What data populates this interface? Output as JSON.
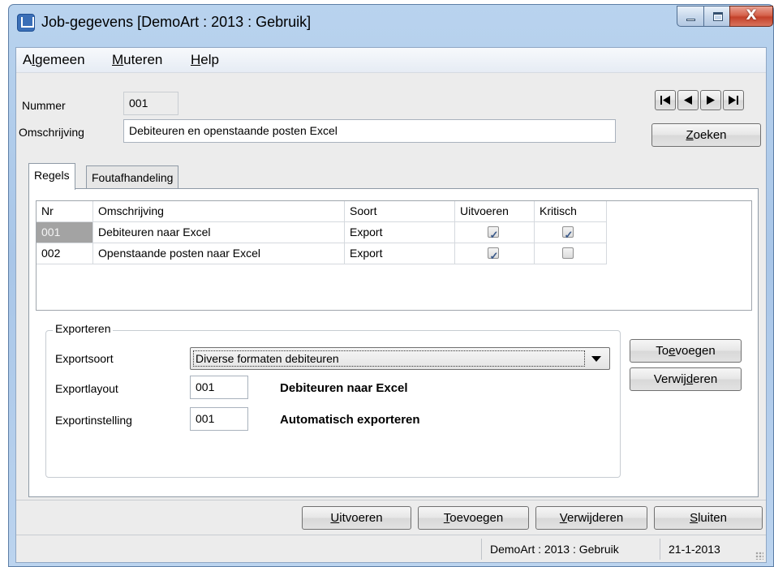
{
  "window": {
    "title": "Job-gegevens  [DemoArt : 2013 : Gebruik]",
    "close_symbol": "X"
  },
  "menu": {
    "items": [
      {
        "pre": "A",
        "acc": "l",
        "post": "gemeen"
      },
      {
        "pre": "",
        "acc": "M",
        "post": "uteren"
      },
      {
        "pre": "",
        "acc": "H",
        "post": "elp"
      }
    ]
  },
  "form": {
    "nummer_label": "Nummer",
    "nummer_value": "001",
    "omschrijving_label": "Omschrijving",
    "omschrijving_value": "Debiteuren en openstaande posten Excel",
    "zoeken": {
      "pre": "",
      "acc": "Z",
      "post": "oeken"
    }
  },
  "nav_icons": [
    "first-record-icon",
    "previous-record-icon",
    "next-record-icon",
    "last-record-icon"
  ],
  "tabs": [
    {
      "label": "Regels",
      "active": true
    },
    {
      "label": "Foutafhandeling",
      "active": false
    }
  ],
  "grid": {
    "headers": [
      "Nr",
      "Omschrijving",
      "Soort",
      "Uitvoeren",
      "Kritisch"
    ],
    "rows": [
      {
        "nr": "001",
        "omschrijving": "Debiteuren naar Excel",
        "soort": "Export",
        "uitvoeren": true,
        "kritisch": true,
        "selected": true
      },
      {
        "nr": "002",
        "omschrijving": "Openstaande posten naar Excel",
        "soort": "Export",
        "uitvoeren": true,
        "kritisch": false,
        "selected": false
      }
    ],
    "check_symbol": "✓"
  },
  "export": {
    "group_title": "Exporteren",
    "exportsoort_label": "Exportsoort",
    "exportsoort_value": "Diverse formaten debiteuren",
    "exportlayout_label": "Exportlayout",
    "exportlayout_value": "001",
    "exportlayout_desc": "Debiteuren naar Excel",
    "exportinstelling_label": "Exportinstelling",
    "exportinstelling_value": "001",
    "exportinstelling_desc": "Automatisch exporteren",
    "toevoegen": {
      "pre": "To",
      "acc": "e",
      "post": "voegen"
    },
    "verwijderen": {
      "pre": "Verwij",
      "acc": "d",
      "post": "eren"
    }
  },
  "footer_buttons": {
    "uitvoeren": {
      "pre": "",
      "acc": "U",
      "post": "itvoeren"
    },
    "toevoegen": {
      "pre": "",
      "acc": "T",
      "post": "oevoegen"
    },
    "verwijderen": {
      "pre": "",
      "acc": "V",
      "post": "erwijderen"
    },
    "sluiten": {
      "pre": "",
      "acc": "S",
      "post": "luiten"
    }
  },
  "status": {
    "context": "DemoArt : 2013 : Gebruik",
    "date": "21-1-2013"
  },
  "colors": {
    "titlebar": "#b9d3ee",
    "client_bg": "#ececec",
    "selected_cell": "#a3a3a3"
  }
}
